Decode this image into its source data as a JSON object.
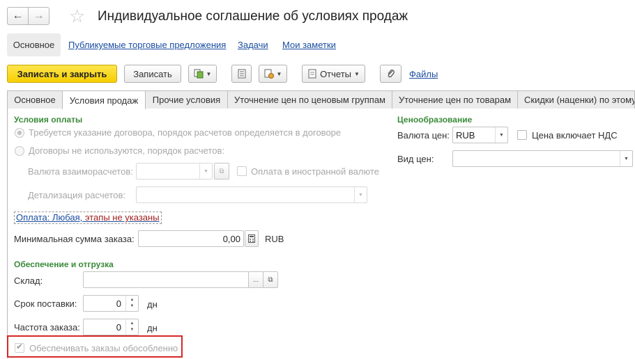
{
  "window": {
    "title": "Индивидуальное соглашение об условиях продаж",
    "back_icon": "←",
    "forward_icon": "→",
    "favorite_icon": "☆"
  },
  "form_nav": {
    "items": [
      {
        "label": "Основное",
        "active": true
      },
      {
        "label": "Публикуемые торговые предложения",
        "active": false
      },
      {
        "label": "Задачи",
        "active": false
      },
      {
        "label": "Мои заметки",
        "active": false
      }
    ]
  },
  "toolbar": {
    "save_close": "Записать и закрыть",
    "save": "Записать",
    "reports": "Отчеты",
    "files": "Файлы"
  },
  "tabs": [
    {
      "label": "Основное",
      "active": false
    },
    {
      "label": "Условия продаж",
      "active": true
    },
    {
      "label": "Прочие условия",
      "active": false
    },
    {
      "label": "Уточнение цен по ценовым группам",
      "active": false
    },
    {
      "label": "Уточнение цен по товарам",
      "active": false
    },
    {
      "label": "Скидки (наценки) по этому",
      "active": false
    }
  ],
  "payment": {
    "group_title": "Условия оплаты",
    "option1": "Требуется указание договора, порядок расчетов определяется в договоре",
    "option2": "Договоры не используются, порядок расчетов:",
    "settlement_currency_label": "Валюта взаиморасчетов:",
    "foreign_currency_label": "Оплата в иностранной валюте",
    "detail_label": "Детализация расчетов:",
    "link_part1": "Оплата: Любая,",
    "link_part2": "этапы не указаны",
    "min_order_label": "Минимальная сумма заказа:",
    "min_order_value": "0,00",
    "min_order_currency": "RUB"
  },
  "pricing": {
    "group_title": "Ценообразование",
    "currency_label": "Валюта цен:",
    "currency_value": "RUB",
    "vat_label": "Цена включает НДС",
    "price_type_label": "Вид цен:"
  },
  "supply": {
    "group_title": "Обеспечение и отгрузка",
    "warehouse_label": "Склад:",
    "delivery_label": "Срок поставки:",
    "delivery_value": "0",
    "delivery_unit": "дн",
    "frequency_label": "Частота заказа:",
    "frequency_value": "0",
    "frequency_unit": "дн",
    "separate_label": "Обеспечивать заказы обособленно"
  },
  "colors": {
    "primary_button": "#f6cf00",
    "link": "#1b4da0",
    "group_title": "#3a8a3a",
    "highlight": "#d62828"
  }
}
